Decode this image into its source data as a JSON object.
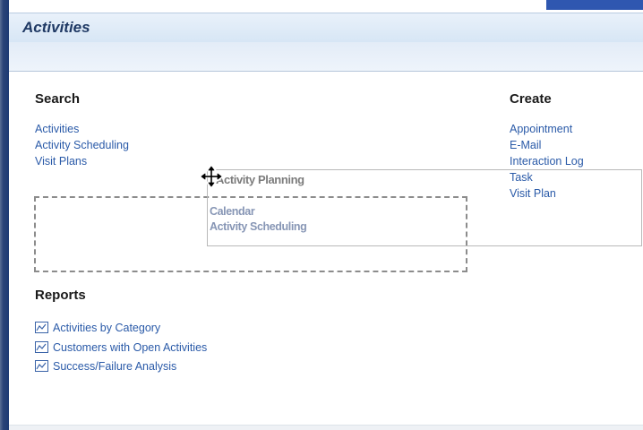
{
  "header": {
    "title": "Activities"
  },
  "search": {
    "heading": "Search",
    "links": [
      {
        "label": "Activities"
      },
      {
        "label": "Activity Scheduling"
      },
      {
        "label": "Visit Plans"
      }
    ]
  },
  "create": {
    "heading": "Create",
    "links": [
      {
        "label": "Appointment"
      },
      {
        "label": "E-Mail"
      },
      {
        "label": "Interaction Log"
      },
      {
        "label": "Task"
      },
      {
        "label": "Visit Plan"
      }
    ]
  },
  "dragged_group": {
    "title": "Activity Planning",
    "links": [
      {
        "label": "Calendar"
      },
      {
        "label": "Activity Scheduling"
      }
    ]
  },
  "reports": {
    "heading": "Reports",
    "icon": "report-chart-icon",
    "links": [
      {
        "label": "Activities by Category"
      },
      {
        "label": "Customers with Open Activities"
      },
      {
        "label": "Success/Failure Analysis"
      }
    ]
  },
  "cursor": {
    "icon": "move-cursor-icon"
  },
  "colors": {
    "link": "#2a5aa8",
    "title": "#1f3964",
    "rail": "#1d3a73",
    "accent": "#2f57b0",
    "header_bg": "#dde9f6"
  }
}
